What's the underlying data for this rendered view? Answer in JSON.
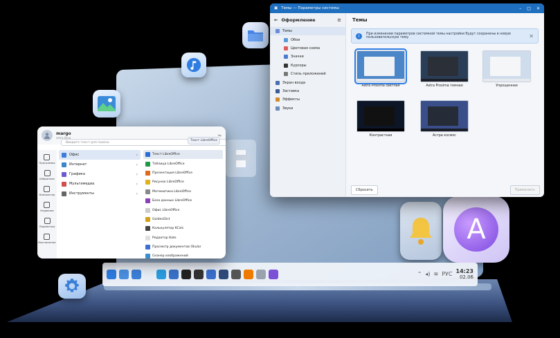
{
  "start_menu": {
    "user_name": "margo",
    "user_sub": "astra-linux",
    "search_placeholder": "Введите текст для поиска",
    "search_chip": "Текст LibreOffice",
    "left_items": [
      {
        "label": "Программы",
        "icon": "grid-icon"
      },
      {
        "label": "Избранное",
        "icon": "bookmark-icon"
      },
      {
        "label": "Компьютер",
        "icon": "monitor-icon"
      },
      {
        "label": "Недавние",
        "icon": "clock-icon"
      },
      {
        "label": "Параметры",
        "icon": "gear-icon"
      },
      {
        "label": "Выключение",
        "icon": "power-icon"
      }
    ],
    "categories": [
      {
        "label": "Офис",
        "color": "#3b7dd8",
        "selected": true
      },
      {
        "label": "Интернет",
        "color": "#3a86c8",
        "selected": false
      },
      {
        "label": "Графика",
        "color": "#6b5bd0",
        "selected": false
      },
      {
        "label": "Мультимедиа",
        "color": "#d05050",
        "selected": false
      },
      {
        "label": "Инструменты",
        "color": "#666666",
        "selected": false
      }
    ],
    "apps": [
      {
        "label": "Текст LibreOffice",
        "color": "#2b6fd6",
        "selected": true
      },
      {
        "label": "Таблица LibreOffice",
        "color": "#1e9a45",
        "selected": false
      },
      {
        "label": "Презентация LibreOffice",
        "color": "#e06a1a",
        "selected": false
      },
      {
        "label": "Рисунок LibreOffice",
        "color": "#e2b21a",
        "selected": false
      },
      {
        "label": "Математика LibreOffice",
        "color": "#888888",
        "selected": false
      },
      {
        "label": "База данных LibreOffice",
        "color": "#8a3fb8",
        "selected": false
      },
      {
        "label": "Офис LibreOffice",
        "color": "#cccccc",
        "selected": false
      },
      {
        "label": "GoldenDict",
        "color": "#d4a017",
        "selected": false
      },
      {
        "label": "Калькулятор KCalc",
        "color": "#444444",
        "selected": false
      },
      {
        "label": "Редактор Kate",
        "color": "#e0e0e0",
        "selected": false
      },
      {
        "label": "Просмотр документов Okular",
        "color": "#3d6fd1",
        "selected": false
      },
      {
        "label": "Сканер изображений",
        "color": "#3a8fcc",
        "selected": false
      }
    ]
  },
  "settings": {
    "window_title": "Темы — Параметры системы",
    "sidebar_title": "Оформление",
    "nav": [
      {
        "label": "Темы",
        "level": "parent",
        "color": "#6a8bd8",
        "selected": true
      },
      {
        "label": "Обои",
        "level": "child",
        "color": "#5a9ad8",
        "selected": false
      },
      {
        "label": "Цветовая схема",
        "level": "child",
        "color": "#e05a5a",
        "selected": false
      },
      {
        "label": "Значки",
        "level": "child",
        "color": "#4a7bd0",
        "selected": false
      },
      {
        "label": "Курсоры",
        "level": "child",
        "color": "#333333",
        "selected": false
      },
      {
        "label": "Стиль приложений",
        "level": "child",
        "color": "#777777",
        "selected": false
      },
      {
        "label": "Экран входа",
        "level": "parent",
        "color": "#4a6fb0",
        "selected": false
      },
      {
        "label": "Заставка",
        "level": "parent",
        "color": "#3b5a9a",
        "selected": false
      },
      {
        "label": "Эффекты",
        "level": "parent",
        "color": "#d08a2a",
        "selected": false
      },
      {
        "label": "Звуки",
        "level": "parent",
        "color": "#6a8ab8",
        "selected": false
      }
    ],
    "main_title": "Темы",
    "info_text": "При изменении параметров системной темы настройки будут сохранены в новую пользовательскую тему.",
    "themes": [
      {
        "label": "Astra Proxima светлая",
        "bg": "#4b86c9",
        "win": "#eef2f7",
        "bar": "#e3e8ef",
        "selected": true
      },
      {
        "label": "Astra Proxima темная",
        "bg": "#2b3e58",
        "win": "#2a2f38",
        "bar": "#1d2028",
        "selected": false
      },
      {
        "label": "Упрощенная",
        "bg": "#cfdcec",
        "win": "#f5f6f8",
        "bar": "#e6e9ee",
        "selected": false
      },
      {
        "label": "Контрастная",
        "bg": "#0d1626",
        "win": "#111111",
        "bar": "#000000",
        "selected": false
      },
      {
        "label": "Астра космос",
        "bg": "#3a4f8a",
        "win": "#262b38",
        "bar": "#1a1e28",
        "selected": false
      }
    ],
    "reset_label": "Сбросить",
    "apply_label": "Применить"
  },
  "taskbar": {
    "apps": [
      {
        "icon": "star-icon",
        "color": "#2d7be0"
      },
      {
        "icon": "folder-icon",
        "color": "#4a8fe0"
      },
      {
        "icon": "folder-open-icon",
        "color": "#3c7fd8"
      },
      {
        "icon": "document-icon",
        "color": "#e8eef7"
      },
      {
        "icon": "telegram-icon",
        "color": "#2a9de0"
      },
      {
        "icon": "browser-icon",
        "color": "#3a72c8"
      },
      {
        "icon": "crow-icon",
        "color": "#222222"
      },
      {
        "icon": "penguin-icon",
        "color": "#333333"
      },
      {
        "icon": "dove-icon",
        "color": "#3a6fcc"
      },
      {
        "icon": "terminal-icon",
        "color": "#2f4b7a"
      },
      {
        "icon": "monitor-app-icon",
        "color": "#555555"
      },
      {
        "icon": "vlc-icon",
        "color": "#ef7a00"
      },
      {
        "icon": "eye-icon",
        "color": "#9aa3ad"
      },
      {
        "icon": "astra-icon",
        "color": "#7b4fd6"
      }
    ],
    "keyboard_layout": "РУС",
    "time": "14:23",
    "date": "02.06"
  }
}
